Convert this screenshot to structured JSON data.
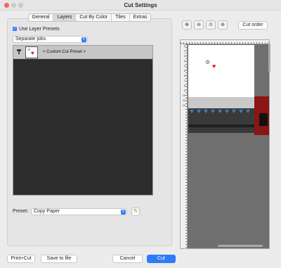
{
  "window": {
    "title": "Cut Settings"
  },
  "tabs": [
    "General",
    "Layers",
    "Cut By Color",
    "Tiles",
    "Extras"
  ],
  "active_tab": "Layers",
  "use_layer_presets": {
    "label": "Use Layer Presets",
    "checked": true
  },
  "job_mode": {
    "value": "Separate jobs"
  },
  "layers": [
    {
      "name": "< Custom Cut Preset >"
    }
  ],
  "preset": {
    "label": "Preset:",
    "value": "Copy Paper"
  },
  "preview": {
    "cut_order_label": "Cut order",
    "ruler_numbers": [
      "0",
      "1",
      "2",
      "3",
      "4",
      "5",
      "6",
      "7",
      "8",
      "9",
      "10",
      "11",
      "12"
    ]
  },
  "footer": {
    "print_cut": "Print+Cut",
    "save_to_file": "Save to file",
    "cancel": "Cancel",
    "cut": "Cut"
  },
  "colors": {
    "accent": "#2e7cf6",
    "mat_red": "#8b1414",
    "heart": "#e01818"
  }
}
